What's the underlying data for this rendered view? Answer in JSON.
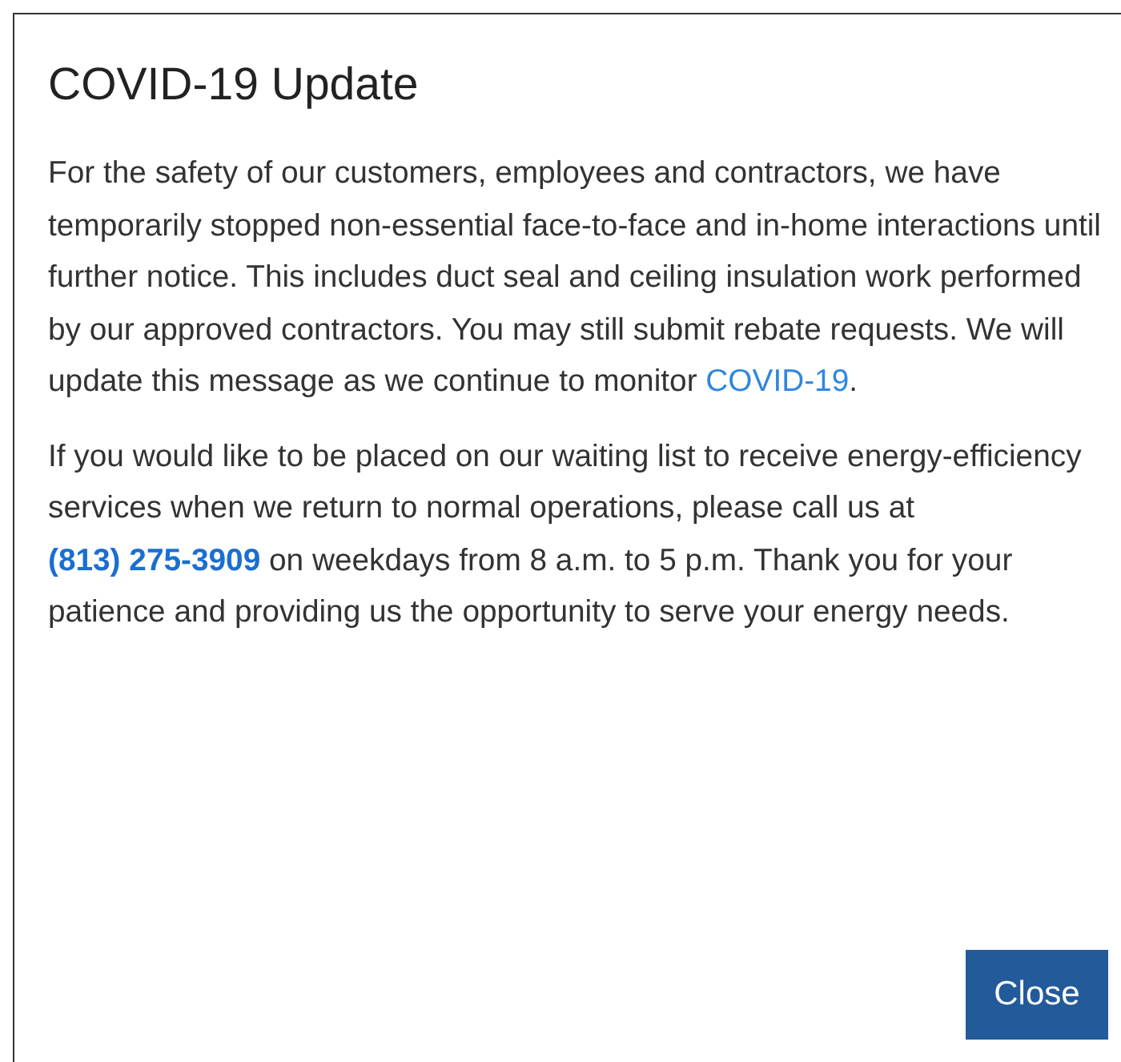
{
  "dialog": {
    "title": "COVID-19 Update",
    "paragraphs": [
      [
        {
          "kind": "text",
          "text": "For the safety of our customers, employees and contractors, we have temporarily stopped non-essential face-to-face and in-home interactions until further notice. This includes duct seal and ceiling insulation work performed by our approved contractors. You may still submit rebate requests. We will update this message as we continue to monitor "
        },
        {
          "kind": "link",
          "text": "COVID-19"
        },
        {
          "kind": "text",
          "text": "."
        }
      ],
      [
        {
          "kind": "text",
          "text": "If you would like to be placed on our waiting list to receive energy-efficiency services when we return to normal operations, please call us at "
        },
        {
          "kind": "strong-link",
          "text": "(813) 275-3909"
        },
        {
          "kind": "text",
          "text": " on weekdays from 8 a.m. to 5 p.m. Thank you for your patience and providing us the opportunity to serve your energy needs."
        }
      ]
    ],
    "buttons": [
      "Close"
    ]
  }
}
